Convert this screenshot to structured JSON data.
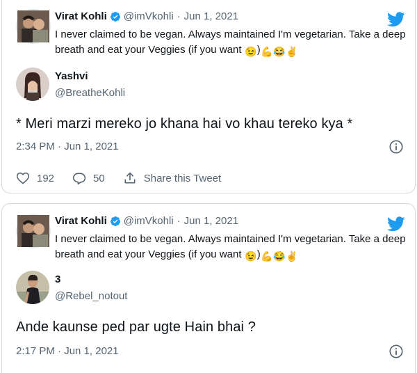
{
  "tweets": [
    {
      "quoted": {
        "name": "Virat Kohli",
        "handle": "@imVkohli",
        "dot": "·",
        "date": "Jun 1, 2021",
        "text": "I never claimed to be vegan. Always maintained I'm vegetarian. Take a deep breath and eat your Veggies (if you want "
      },
      "reply": {
        "name": "Yashvi",
        "handle": "@BreatheKohli"
      },
      "text": "* Meri marzi mereko jo khana hai vo khau tereko kya *",
      "timestamp": "2:34 PM · Jun 1, 2021",
      "actions": {
        "likes": "192",
        "replies": "50",
        "share_label": "Share this Tweet"
      }
    },
    {
      "quoted": {
        "name": "Virat Kohli",
        "handle": "@imVkohli",
        "dot": "·",
        "date": "Jun 1, 2021",
        "text": "I never claimed to be vegan. Always maintained I'm vegetarian. Take a deep breath and eat your Veggies (if you want "
      },
      "reply": {
        "name": "3",
        "handle": "@Rebel_notout"
      },
      "text": "Ande kaunse ped par ugte Hain bhai ?",
      "timestamp": "2:17 PM · Jun 1, 2021"
    }
  ],
  "emojis": [
    "winking-face",
    "flexed-biceps",
    "tears-of-joy",
    "victory-hand"
  ],
  "colors": {
    "brand": "#1d9bf0",
    "secondary_text": "#536471",
    "border": "#cfd9de"
  }
}
